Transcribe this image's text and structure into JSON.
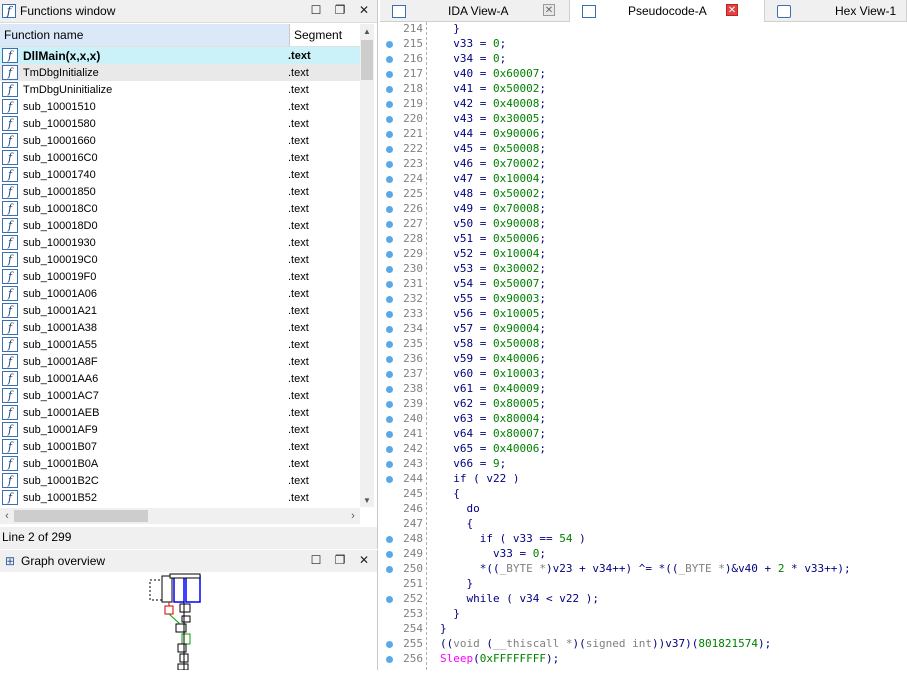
{
  "functions_window": {
    "title": "Functions window",
    "col_name": "Function name",
    "col_segment": "Segment",
    "rows": [
      {
        "name": "DllMain(x,x,x)",
        "segment": ".text"
      },
      {
        "name": "TmDbgInitialize",
        "segment": ".text"
      },
      {
        "name": "TmDbgUninitialize",
        "segment": ".text"
      },
      {
        "name": "sub_10001510",
        "segment": ".text"
      },
      {
        "name": "sub_10001580",
        "segment": ".text"
      },
      {
        "name": "sub_10001660",
        "segment": ".text"
      },
      {
        "name": "sub_100016C0",
        "segment": ".text"
      },
      {
        "name": "sub_10001740",
        "segment": ".text"
      },
      {
        "name": "sub_10001850",
        "segment": ".text"
      },
      {
        "name": "sub_100018C0",
        "segment": ".text"
      },
      {
        "name": "sub_100018D0",
        "segment": ".text"
      },
      {
        "name": "sub_10001930",
        "segment": ".text"
      },
      {
        "name": "sub_100019C0",
        "segment": ".text"
      },
      {
        "name": "sub_100019F0",
        "segment": ".text"
      },
      {
        "name": "sub_10001A06",
        "segment": ".text"
      },
      {
        "name": "sub_10001A21",
        "segment": ".text"
      },
      {
        "name": "sub_10001A38",
        "segment": ".text"
      },
      {
        "name": "sub_10001A55",
        "segment": ".text"
      },
      {
        "name": "sub_10001A8F",
        "segment": ".text"
      },
      {
        "name": "sub_10001AA6",
        "segment": ".text"
      },
      {
        "name": "sub_10001AC7",
        "segment": ".text"
      },
      {
        "name": "sub_10001AEB",
        "segment": ".text"
      },
      {
        "name": "sub_10001AF9",
        "segment": ".text"
      },
      {
        "name": "sub_10001B07",
        "segment": ".text"
      },
      {
        "name": "sub_10001B0A",
        "segment": ".text"
      },
      {
        "name": "sub_10001B2C",
        "segment": ".text"
      },
      {
        "name": "sub_10001B52",
        "segment": ".text"
      }
    ],
    "status": "Line 2 of 299"
  },
  "graph_overview": {
    "title": "Graph overview"
  },
  "tabs": [
    {
      "label": "IDA View-A"
    },
    {
      "label": "Pseudocode-A"
    },
    {
      "label": "Hex View-1"
    }
  ],
  "code_lines": [
    {
      "n": "214",
      "dot": false,
      "t": "  }"
    },
    {
      "n": "215",
      "dot": true,
      "t": "  v33 = 0;"
    },
    {
      "n": "216",
      "dot": true,
      "t": "  v34 = 0;"
    },
    {
      "n": "217",
      "dot": true,
      "t": "  v40 = 0x60007;"
    },
    {
      "n": "218",
      "dot": true,
      "t": "  v41 = 0x50002;"
    },
    {
      "n": "219",
      "dot": true,
      "t": "  v42 = 0x40008;"
    },
    {
      "n": "220",
      "dot": true,
      "t": "  v43 = 0x30005;"
    },
    {
      "n": "221",
      "dot": true,
      "t": "  v44 = 0x90006;"
    },
    {
      "n": "222",
      "dot": true,
      "t": "  v45 = 0x50008;"
    },
    {
      "n": "223",
      "dot": true,
      "t": "  v46 = 0x70002;"
    },
    {
      "n": "224",
      "dot": true,
      "t": "  v47 = 0x10004;"
    },
    {
      "n": "225",
      "dot": true,
      "t": "  v48 = 0x50002;"
    },
    {
      "n": "226",
      "dot": true,
      "t": "  v49 = 0x70008;"
    },
    {
      "n": "227",
      "dot": true,
      "t": "  v50 = 0x90008;"
    },
    {
      "n": "228",
      "dot": true,
      "t": "  v51 = 0x50006;"
    },
    {
      "n": "229",
      "dot": true,
      "t": "  v52 = 0x10004;"
    },
    {
      "n": "230",
      "dot": true,
      "t": "  v53 = 0x30002;"
    },
    {
      "n": "231",
      "dot": true,
      "t": "  v54 = 0x50007;"
    },
    {
      "n": "232",
      "dot": true,
      "t": "  v55 = 0x90003;"
    },
    {
      "n": "233",
      "dot": true,
      "t": "  v56 = 0x10005;"
    },
    {
      "n": "234",
      "dot": true,
      "t": "  v57 = 0x90004;"
    },
    {
      "n": "235",
      "dot": true,
      "t": "  v58 = 0x50008;"
    },
    {
      "n": "236",
      "dot": true,
      "t": "  v59 = 0x40006;"
    },
    {
      "n": "237",
      "dot": true,
      "t": "  v60 = 0x10003;"
    },
    {
      "n": "238",
      "dot": true,
      "t": "  v61 = 0x40009;"
    },
    {
      "n": "239",
      "dot": true,
      "t": "  v62 = 0x80005;"
    },
    {
      "n": "240",
      "dot": true,
      "t": "  v63 = 0x80004;"
    },
    {
      "n": "241",
      "dot": true,
      "t": "  v64 = 0x80007;"
    },
    {
      "n": "242",
      "dot": true,
      "t": "  v65 = 0x40006;"
    },
    {
      "n": "243",
      "dot": true,
      "t": "  v66 = 9;"
    },
    {
      "n": "244",
      "dot": true,
      "t": "  if ( v22 )"
    },
    {
      "n": "245",
      "dot": false,
      "t": "  {"
    },
    {
      "n": "246",
      "dot": false,
      "t": "    do"
    },
    {
      "n": "247",
      "dot": false,
      "t": "    {"
    },
    {
      "n": "248",
      "dot": true,
      "t": "      if ( v33 == 54 )"
    },
    {
      "n": "249",
      "dot": true,
      "t": "        v33 = 0;"
    },
    {
      "n": "250",
      "dot": true,
      "t": "      *((_BYTE *)v23 + v34++) ^= *((_BYTE *)&v40 + 2 * v33++);"
    },
    {
      "n": "251",
      "dot": false,
      "t": "    }"
    },
    {
      "n": "252",
      "dot": true,
      "t": "    while ( v34 < v22 );"
    },
    {
      "n": "253",
      "dot": false,
      "t": "  }"
    },
    {
      "n": "254",
      "dot": false,
      "t": "}"
    },
    {
      "n": "255",
      "dot": true,
      "t": "((void (__thiscall *)(signed int))v37)(801821574);"
    },
    {
      "n": "256",
      "dot": true,
      "t": "Sleep(0xFFFFFFFF);"
    }
  ]
}
